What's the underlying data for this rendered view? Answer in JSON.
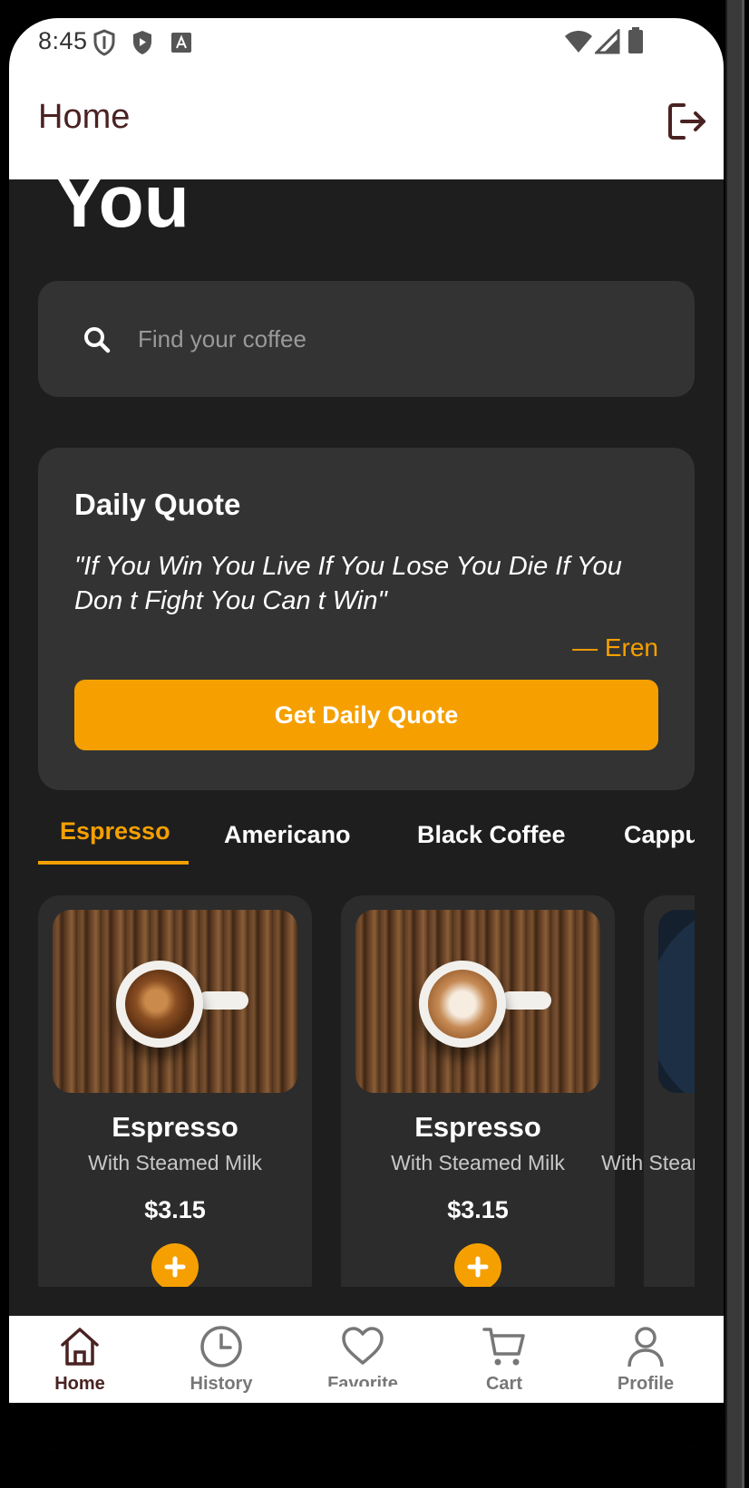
{
  "status_bar": {
    "time": "8:45"
  },
  "app_bar": {
    "title": "Home"
  },
  "heading": "You",
  "search": {
    "placeholder": "Find your coffee"
  },
  "quote_card": {
    "title": "Daily Quote",
    "quote": "\"If You Win You Live If You Lose You Die If You Don t Fight You Can t Win\"",
    "author": "— Eren",
    "button_label": "Get Daily Quote"
  },
  "tabs": [
    {
      "label": "Espresso",
      "active": true
    },
    {
      "label": "Americano",
      "active": false
    },
    {
      "label": "Black Coffee",
      "active": false
    },
    {
      "label": "Cappuccino",
      "active": false
    }
  ],
  "products": [
    {
      "name": "Espresso",
      "subtitle": "With Steamed Milk",
      "price": "$3.15"
    },
    {
      "name": "Espresso",
      "subtitle": "With Steamed Milk",
      "price": "$3.15"
    },
    {
      "name": "",
      "subtitle": "With Steamed Milk",
      "price": ""
    }
  ],
  "bottom_nav": [
    {
      "label": "Home",
      "icon": "home-icon",
      "active": true
    },
    {
      "label": "History",
      "icon": "history-icon",
      "active": false
    },
    {
      "label": "Favorite",
      "icon": "heart-icon",
      "active": false
    },
    {
      "label": "Cart",
      "icon": "cart-icon",
      "active": false
    },
    {
      "label": "Profile",
      "icon": "profile-icon",
      "active": false
    }
  ],
  "colors": {
    "accent": "#f5a000",
    "background": "#1e1e1e",
    "surface": "#333333",
    "brand_text": "#4a2222"
  }
}
